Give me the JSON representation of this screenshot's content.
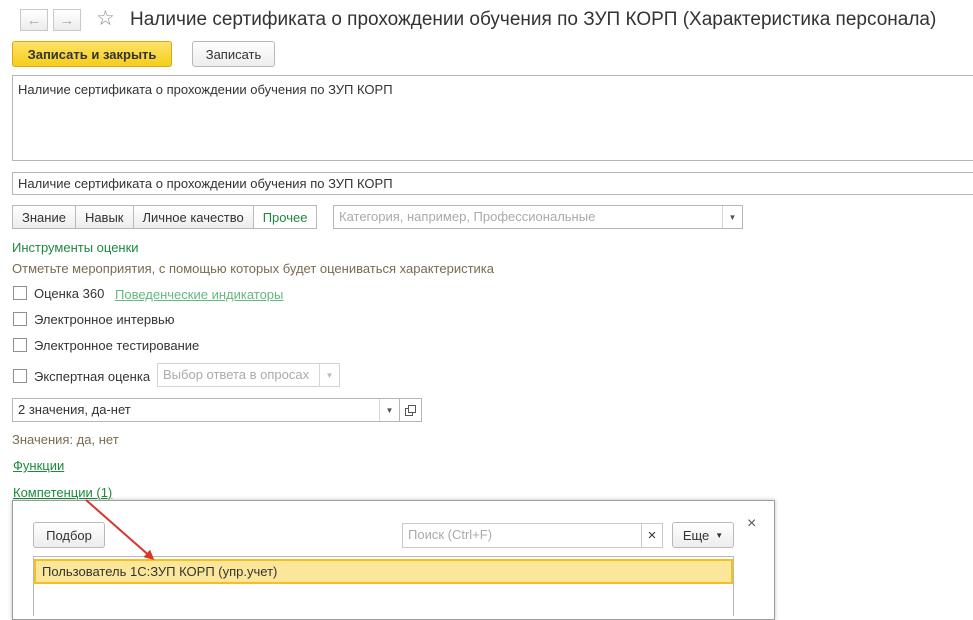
{
  "header": {
    "back_symbol": "←",
    "forward_symbol": "→",
    "favorite_symbol": "☆",
    "title": "Наличие сертификата о прохождении обучения по ЗУП КОРП (Характеристика персонала)"
  },
  "toolbar": {
    "save_close_label": "Записать и закрыть",
    "save_label": "Записать"
  },
  "form": {
    "description_value": "Наличие сертификата о прохождении обучения по ЗУП КОРП",
    "name_value": "Наличие сертификата о прохождении обучения по ЗУП КОРП",
    "type_tabs": [
      {
        "label": "Знание",
        "active": false
      },
      {
        "label": "Навык",
        "active": false
      },
      {
        "label": "Личное качество",
        "active": false
      },
      {
        "label": "Прочее",
        "active": true
      }
    ],
    "category_placeholder": "Категория, например, Профессиональные",
    "tools_title": "Инструменты оценки",
    "tools_hint": "Отметьте мероприятия, с помощью которых будет оцениваться характеристика",
    "checkboxes": {
      "score360": {
        "label": "Оценка 360",
        "checked": false
      },
      "interview": {
        "label": "Электронное интервью",
        "checked": false
      },
      "testing": {
        "label": "Электронное тестирование",
        "checked": false
      },
      "expert": {
        "label": "Экспертная оценка",
        "checked": false
      }
    },
    "behavior_link": "Поведенческие индикаторы",
    "answer_choice_placeholder": "Выбор ответа в опросах",
    "values_field": "2 значения, да-нет",
    "values_hint": "Значения: да, нет",
    "functions_link": "Функции",
    "competencies_link": "Компетенции (1)"
  },
  "popup": {
    "pick_label": "Подбор",
    "search_placeholder": "Поиск (Ctrl+F)",
    "clear_symbol": "×",
    "more_label": "Еще",
    "close_symbol": "×",
    "rows": [
      "Пользователь 1С:ЗУП КОРП (упр.учет)"
    ]
  },
  "colors": {
    "accent_green": "#1c8a3c",
    "primary_button": "#f6cd1a",
    "selected_row": "#fbe69a",
    "arrow": "#d9352b"
  },
  "icons": [
    "arrow-left-icon",
    "arrow-right-icon",
    "star-icon",
    "dropdown-icon",
    "open-icon",
    "clear-icon",
    "close-icon"
  ]
}
